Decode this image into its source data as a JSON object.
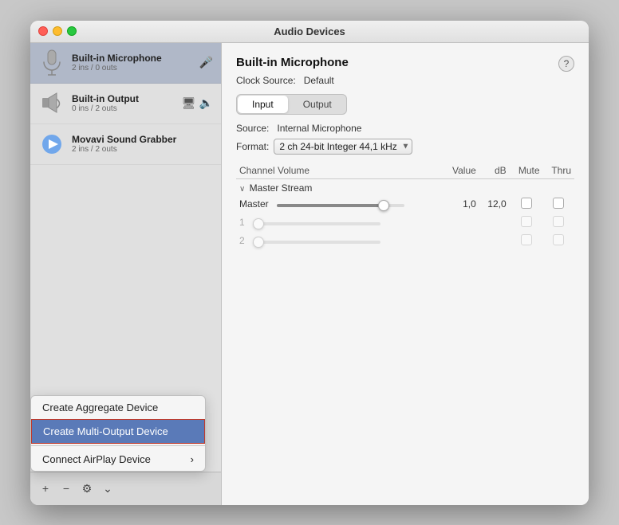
{
  "window": {
    "title": "Audio Devices"
  },
  "left_panel": {
    "devices": [
      {
        "id": "built-in-microphone",
        "name": "Built-in Microphone",
        "desc": "2 ins / 0 outs",
        "icon": "mic",
        "selected": true,
        "badges": [
          "mic"
        ]
      },
      {
        "id": "built-in-output",
        "name": "Built-in Output",
        "desc": "0 ins / 2 outs",
        "icon": "speaker",
        "selected": false,
        "badges": [
          "monitor",
          "speaker"
        ]
      },
      {
        "id": "movavi-sound-grabber",
        "name": "Movavi Sound Grabber",
        "desc": "2 ins / 2 outs",
        "icon": "movavi",
        "selected": false,
        "badges": []
      }
    ]
  },
  "toolbar": {
    "add_label": "+",
    "remove_label": "−",
    "gear_label": "⚙",
    "chevron_label": "⌄"
  },
  "dropdown": {
    "items": [
      {
        "id": "create-aggregate",
        "label": "Create Aggregate Device",
        "highlighted": false,
        "has_arrow": false
      },
      {
        "id": "create-multi-output",
        "label": "Create Multi-Output Device",
        "highlighted": true,
        "has_arrow": false
      },
      {
        "id": "connect-airplay",
        "label": "Connect AirPlay Device",
        "highlighted": false,
        "has_arrow": true
      }
    ]
  },
  "right_panel": {
    "device_name": "Built-in Microphone",
    "clock_source_label": "Clock Source:",
    "clock_source_value": "Default",
    "help_label": "?",
    "tabs": [
      {
        "id": "input",
        "label": "Input",
        "active": true
      },
      {
        "id": "output",
        "label": "Output",
        "active": false
      }
    ],
    "source_label": "Source:",
    "source_value": "Internal Microphone",
    "format_label": "Format:",
    "format_value": "2 ch 24-bit Integer 44,1 kHz",
    "channel_table": {
      "headers": [
        "Channel Volume",
        "Value",
        "dB",
        "Mute",
        "Thru"
      ],
      "master_stream_label": "Master Stream",
      "rows": [
        {
          "id": "master",
          "label": "Master",
          "slider_value": 87,
          "value": "1,0",
          "db": "12,0",
          "mute": false,
          "thru": false,
          "disabled": false
        },
        {
          "id": "ch1",
          "label": "1",
          "slider_value": 0,
          "value": "",
          "db": "",
          "mute": false,
          "thru": false,
          "disabled": true
        },
        {
          "id": "ch2",
          "label": "2",
          "slider_value": 0,
          "value": "",
          "db": "",
          "mute": false,
          "thru": false,
          "disabled": true
        }
      ]
    }
  }
}
